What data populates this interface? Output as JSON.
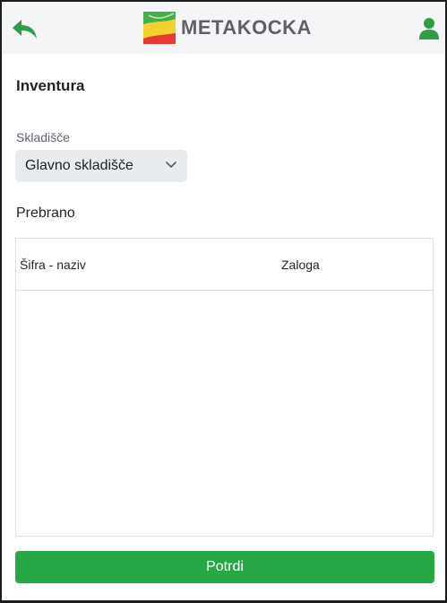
{
  "header": {
    "logo_text": "METAKOCKA",
    "back_icon": "back-arrow-icon",
    "user_icon": "user-icon",
    "accent_color": "#2e9e49"
  },
  "page": {
    "title": "Inventura"
  },
  "warehouse": {
    "label": "Skladišče",
    "selected": "Glavno skladišče"
  },
  "counted": {
    "label": "Prebrano",
    "columns": [
      "Šifra - naziv",
      "Zaloga"
    ],
    "rows": []
  },
  "actions": {
    "confirm_label": "Potrdi",
    "confirm_color": "#28a745"
  }
}
